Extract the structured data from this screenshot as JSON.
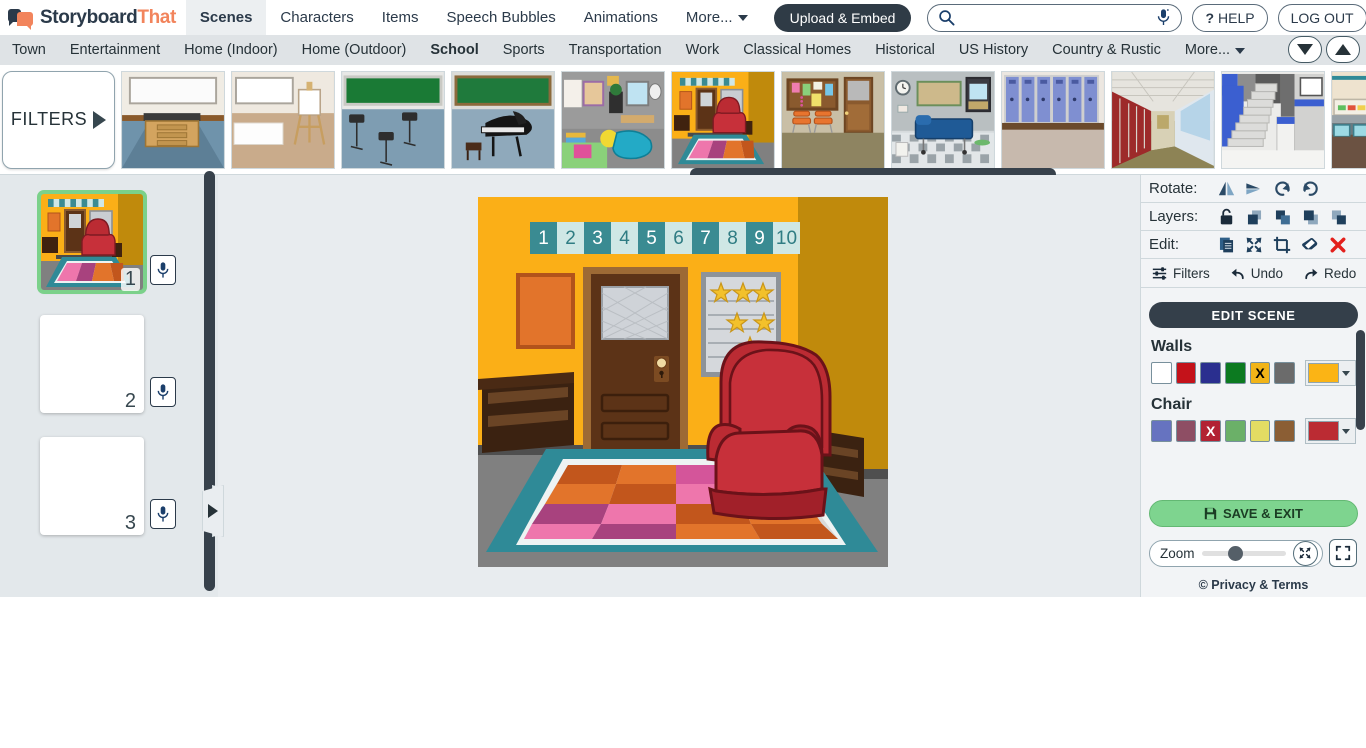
{
  "header": {
    "logo": {
      "part1": "Storyboard",
      "part2": "That",
      "icon": "speech-bubbles-logo-icon"
    },
    "tabs": [
      {
        "label": "Scenes",
        "active": true
      },
      {
        "label": "Characters",
        "active": false
      },
      {
        "label": "Items",
        "active": false
      },
      {
        "label": "Speech Bubbles",
        "active": false
      },
      {
        "label": "Animations",
        "active": false
      },
      {
        "label": "More...",
        "active": false,
        "has_caret": true
      }
    ],
    "upload_label": "Upload & Embed",
    "search": {
      "value": "",
      "placeholder": "",
      "icon": "search-icon",
      "mic_icon": "microphone-icon"
    },
    "help_label": "HELP",
    "help_mark": "?",
    "logout_label": "LOG OUT"
  },
  "categories": {
    "items": [
      {
        "label": "Town",
        "active": false
      },
      {
        "label": "Entertainment",
        "active": false
      },
      {
        "label": "Home (Indoor)",
        "active": false
      },
      {
        "label": "Home (Outdoor)",
        "active": false
      },
      {
        "label": "School",
        "active": true
      },
      {
        "label": "Sports",
        "active": false
      },
      {
        "label": "Transportation",
        "active": false
      },
      {
        "label": "Work",
        "active": false
      },
      {
        "label": "Classical Homes",
        "active": false
      },
      {
        "label": "Historical",
        "active": false
      },
      {
        "label": "US History",
        "active": false
      },
      {
        "label": "Country & Rustic",
        "active": false
      },
      {
        "label": "More...",
        "active": false,
        "has_caret": true
      }
    ],
    "scroll_down_icon": "triangle-down-icon",
    "scroll_up_icon": "triangle-up-icon"
  },
  "strip": {
    "filters_label": "FILTERS",
    "filters_arrow_icon": "triangle-right-icon",
    "thumbnails": [
      {
        "name": "classroom-desk-whiteboard"
      },
      {
        "name": "art-room-easel"
      },
      {
        "name": "music-room-stands"
      },
      {
        "name": "music-room-piano"
      },
      {
        "name": "kindergarten-playroom"
      },
      {
        "name": "classroom-door-yellow"
      },
      {
        "name": "hallway-chairs-door"
      },
      {
        "name": "nurse-office"
      },
      {
        "name": "lockers-blue"
      },
      {
        "name": "hallway-lockers-red"
      },
      {
        "name": "stairwell"
      },
      {
        "name": "cafeteria"
      }
    ]
  },
  "storyboard": {
    "cells": [
      {
        "number": "1",
        "selected": true,
        "empty": false,
        "mic_icon": "microphone-icon"
      },
      {
        "number": "2",
        "selected": false,
        "empty": true,
        "mic_icon": "microphone-icon"
      },
      {
        "number": "3",
        "selected": false,
        "empty": true,
        "mic_icon": "microphone-icon"
      }
    ],
    "collapse_left_icon": "triangle-left-icon",
    "collapse_right_icon": "triangle-right-icon",
    "h_scrollbar": "horizontal-scrollbar",
    "v_scrollbar": "vertical-scrollbar"
  },
  "scene": {
    "name": "classroom-door-yellow",
    "wall_color": "#FBAF17",
    "wall_side_color": "#C08A0C",
    "floor_color": "#808080",
    "number_line": [
      "1",
      "2",
      "3",
      "4",
      "5",
      "6",
      "7",
      "8",
      "9",
      "10"
    ],
    "number_line_colors": [
      "#3a8b92",
      "#cfe7e5"
    ],
    "chair_color": "#BB2B33",
    "rug_border_color": "#2f8a97",
    "rug_tiles": [
      [
        "#C2561C",
        "#E2742B",
        "#D4559A",
        "#C45A9B"
      ],
      [
        "#E2742B",
        "#C2561C",
        "#EE76AC",
        "#E2742B"
      ],
      [
        "#A8427E",
        "#EE76AC",
        "#C2561C",
        "#E2742B"
      ],
      [
        "#EE76AC",
        "#A8427E",
        "#E2742B",
        "#C2561C"
      ]
    ],
    "poster_color": "#E2742B",
    "door_color": "#5C3317",
    "star_rows": [
      3,
      2,
      1
    ]
  },
  "rightpanel": {
    "rotate": {
      "label": "Rotate:",
      "icons": [
        "flip-horizontal-icon",
        "flip-vertical-icon",
        "rotate-left-icon",
        "rotate-right-icon"
      ]
    },
    "layers": {
      "label": "Layers:",
      "icons": [
        "lock-icon",
        "bring-to-front-icon",
        "bring-forward-icon",
        "send-backward-icon",
        "send-to-back-icon"
      ]
    },
    "edit": {
      "label": "Edit:",
      "icons": [
        "duplicate-icon",
        "resize-icon",
        "crop-icon",
        "eraser-icon",
        "delete-icon"
      ]
    },
    "actions": [
      {
        "label": "Filters",
        "icon": "sliders-icon"
      },
      {
        "label": "Undo",
        "icon": "undo-icon"
      },
      {
        "label": "Redo",
        "icon": "redo-icon"
      }
    ],
    "edit_scene_label": "EDIT SCENE",
    "color_groups": [
      {
        "title": "Walls",
        "swatches": [
          {
            "color": "#FFFFFF",
            "selected": false
          },
          {
            "color": "#C4121A",
            "selected": false
          },
          {
            "color": "#2A2F8F",
            "selected": false
          },
          {
            "color": "#0C7A20",
            "selected": false
          },
          {
            "color": "#F2B418",
            "selected": true,
            "mark": "X",
            "mark_color": "#000000"
          },
          {
            "color": "#6B6B6B",
            "selected": false
          }
        ],
        "current_color": "#FBB415"
      },
      {
        "title": "Chair",
        "swatches": [
          {
            "color": "#6673C0",
            "selected": false
          },
          {
            "color": "#8E4E64",
            "selected": false
          },
          {
            "color": "#B22233",
            "selected": true,
            "mark": "X",
            "mark_color": "#FFFFFF"
          },
          {
            "color": "#6BB068",
            "selected": false
          },
          {
            "color": "#E3DC63",
            "selected": false
          },
          {
            "color": "#8B5E34",
            "selected": false
          }
        ],
        "current_color": "#BB2B33"
      }
    ],
    "save_exit_label": "SAVE & EXIT",
    "save_icon": "floppy-disk-icon",
    "zoom_label": "Zoom",
    "fit_icon": "fit-to-screen-icon",
    "fullscreen_icon": "fullscreen-icon",
    "privacy_label": "© Privacy & Terms",
    "scrollbar": "panel-scrollbar"
  }
}
